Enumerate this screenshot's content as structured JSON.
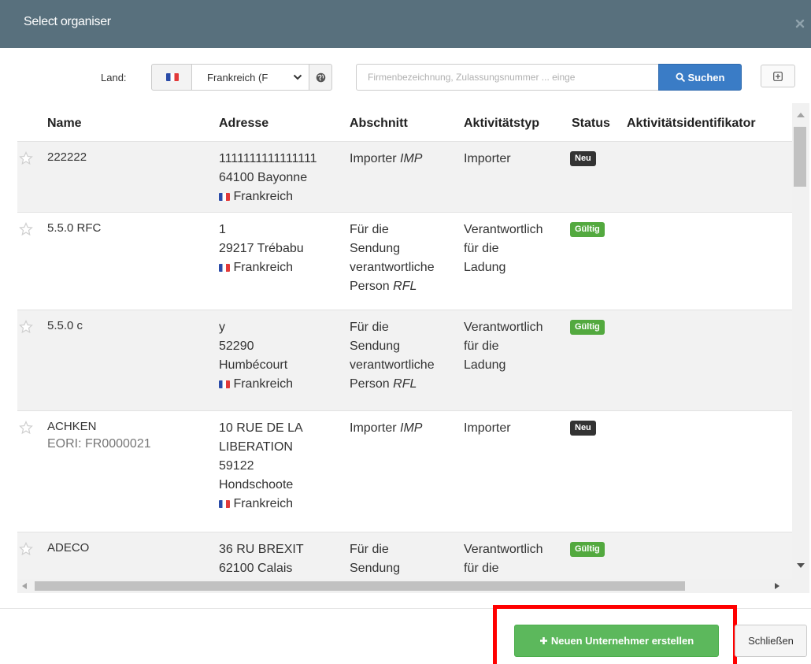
{
  "header": {
    "title": "Select organiser",
    "close_icon": "close-icon"
  },
  "search": {
    "land_label": "Land:",
    "country_value": "Frankreich (F",
    "placeholder": "Firmenbezeichnung, Zulassungsnummer ... einge",
    "search_label": "Suchen"
  },
  "table": {
    "columns": [
      "Name",
      "Adresse",
      "Abschnitt",
      "Aktivitätstyp",
      "Status",
      "Aktivitätsidentifikator"
    ],
    "rows": [
      {
        "name": "222222",
        "addr1": "1111111111111111",
        "addr2": "64100 Bayonne",
        "country": "Frankreich",
        "section": "Importer",
        "section_code": "IMP",
        "activity": "Importer",
        "status": "Neu"
      },
      {
        "name": "5.5.0 RFC",
        "addr1": "1",
        "addr2": "29217 Trébabu",
        "country": "Frankreich",
        "section_line1": "Für die",
        "section_line2": "Sendung",
        "section_line3": "verantwortliche",
        "section_line4": "Person",
        "section_code": "RFL",
        "activity_line1": "Verantwortlich",
        "activity_line2": "für die",
        "activity_line3": "Ladung",
        "status": "Gültig"
      },
      {
        "name": "5.5.0 c",
        "addr1": "y",
        "addr2": "52290",
        "addr3": "Humbécourt",
        "country": "Frankreich",
        "section_line1": "Für die",
        "section_line2": "Sendung",
        "section_line3": "verantwortliche",
        "section_line4": "Person",
        "section_code": "RFL",
        "activity_line1": "Verantwortlich",
        "activity_line2": "für die",
        "activity_line3": "Ladung",
        "status": "Gültig"
      },
      {
        "name": "ACHKEN",
        "eori": "EORI: FR0000021",
        "addr1": "10 RUE DE LA",
        "addr2": "LIBERATION",
        "addr3": "59122",
        "addr4": "Hondschoote",
        "country": "Frankreich",
        "section": "Importer",
        "section_code": "IMP",
        "activity": "Importer",
        "status": "Neu"
      },
      {
        "name": "ADECO",
        "addr1": "36 RU BREXIT",
        "addr2": "62100 Calais",
        "section_line1": "Für die",
        "section_line2": "Sendung",
        "activity_line1": "Verantwortlich",
        "activity_line2": "für die",
        "status": "Gültig"
      }
    ]
  },
  "footer": {
    "create_label": "Neuen Unternehmer erstellen",
    "close_label": "Schließen"
  },
  "colors": {
    "header": "#58707d",
    "primary": "#3a7cc6",
    "success": "#5cb85c",
    "badge_new": "#333333",
    "badge_valid": "#53a93f",
    "highlight": "#ff0000"
  }
}
